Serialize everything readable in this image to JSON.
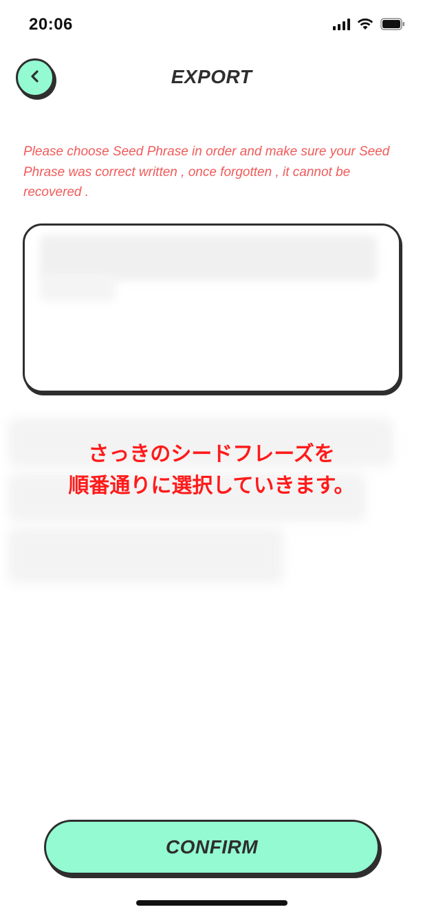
{
  "status_bar": {
    "time": "20:06",
    "icons": [
      "cellular-signal-icon",
      "wifi-icon",
      "battery-icon"
    ]
  },
  "header": {
    "title": "EXPORT",
    "back_icon": "chevron-left-icon"
  },
  "instruction": "Please choose Seed Phrase in order and make sure your Seed Phrase was correct written , once forgotten , it cannot be recovered .",
  "annotation": {
    "line1": "さっきのシードフレーズを",
    "line2": "順番通りに選択していきます。"
  },
  "confirm_label": "CONFIRM",
  "colors": {
    "accent": "#93fad2",
    "outline": "#2e2e2e",
    "warning_text": "#f05a5a",
    "annotation_text": "#ff1a1a"
  }
}
